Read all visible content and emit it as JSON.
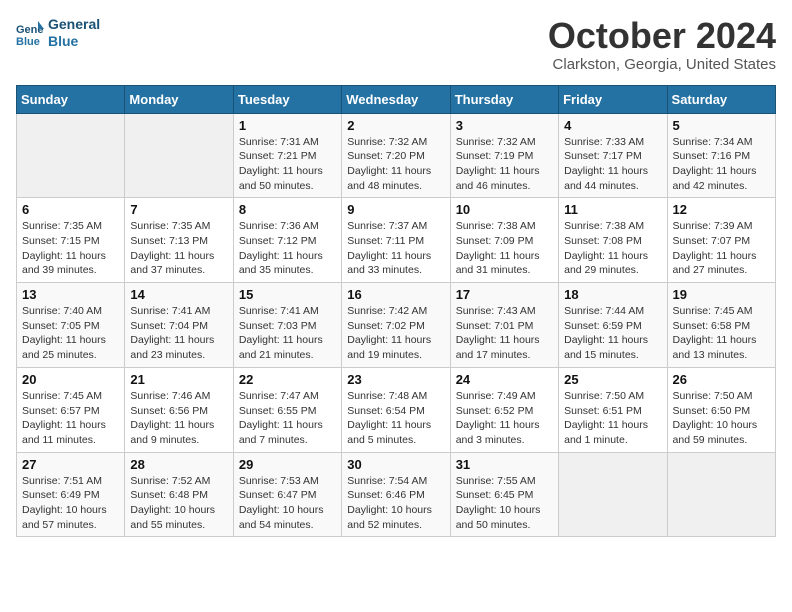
{
  "header": {
    "logo_line1": "General",
    "logo_line2": "Blue",
    "month": "October 2024",
    "location": "Clarkston, Georgia, United States"
  },
  "days_of_week": [
    "Sunday",
    "Monday",
    "Tuesday",
    "Wednesday",
    "Thursday",
    "Friday",
    "Saturday"
  ],
  "weeks": [
    [
      {
        "day": "",
        "info": ""
      },
      {
        "day": "",
        "info": ""
      },
      {
        "day": "1",
        "info": "Sunrise: 7:31 AM\nSunset: 7:21 PM\nDaylight: 11 hours and 50 minutes."
      },
      {
        "day": "2",
        "info": "Sunrise: 7:32 AM\nSunset: 7:20 PM\nDaylight: 11 hours and 48 minutes."
      },
      {
        "day": "3",
        "info": "Sunrise: 7:32 AM\nSunset: 7:19 PM\nDaylight: 11 hours and 46 minutes."
      },
      {
        "day": "4",
        "info": "Sunrise: 7:33 AM\nSunset: 7:17 PM\nDaylight: 11 hours and 44 minutes."
      },
      {
        "day": "5",
        "info": "Sunrise: 7:34 AM\nSunset: 7:16 PM\nDaylight: 11 hours and 42 minutes."
      }
    ],
    [
      {
        "day": "6",
        "info": "Sunrise: 7:35 AM\nSunset: 7:15 PM\nDaylight: 11 hours and 39 minutes."
      },
      {
        "day": "7",
        "info": "Sunrise: 7:35 AM\nSunset: 7:13 PM\nDaylight: 11 hours and 37 minutes."
      },
      {
        "day": "8",
        "info": "Sunrise: 7:36 AM\nSunset: 7:12 PM\nDaylight: 11 hours and 35 minutes."
      },
      {
        "day": "9",
        "info": "Sunrise: 7:37 AM\nSunset: 7:11 PM\nDaylight: 11 hours and 33 minutes."
      },
      {
        "day": "10",
        "info": "Sunrise: 7:38 AM\nSunset: 7:09 PM\nDaylight: 11 hours and 31 minutes."
      },
      {
        "day": "11",
        "info": "Sunrise: 7:38 AM\nSunset: 7:08 PM\nDaylight: 11 hours and 29 minutes."
      },
      {
        "day": "12",
        "info": "Sunrise: 7:39 AM\nSunset: 7:07 PM\nDaylight: 11 hours and 27 minutes."
      }
    ],
    [
      {
        "day": "13",
        "info": "Sunrise: 7:40 AM\nSunset: 7:05 PM\nDaylight: 11 hours and 25 minutes."
      },
      {
        "day": "14",
        "info": "Sunrise: 7:41 AM\nSunset: 7:04 PM\nDaylight: 11 hours and 23 minutes."
      },
      {
        "day": "15",
        "info": "Sunrise: 7:41 AM\nSunset: 7:03 PM\nDaylight: 11 hours and 21 minutes."
      },
      {
        "day": "16",
        "info": "Sunrise: 7:42 AM\nSunset: 7:02 PM\nDaylight: 11 hours and 19 minutes."
      },
      {
        "day": "17",
        "info": "Sunrise: 7:43 AM\nSunset: 7:01 PM\nDaylight: 11 hours and 17 minutes."
      },
      {
        "day": "18",
        "info": "Sunrise: 7:44 AM\nSunset: 6:59 PM\nDaylight: 11 hours and 15 minutes."
      },
      {
        "day": "19",
        "info": "Sunrise: 7:45 AM\nSunset: 6:58 PM\nDaylight: 11 hours and 13 minutes."
      }
    ],
    [
      {
        "day": "20",
        "info": "Sunrise: 7:45 AM\nSunset: 6:57 PM\nDaylight: 11 hours and 11 minutes."
      },
      {
        "day": "21",
        "info": "Sunrise: 7:46 AM\nSunset: 6:56 PM\nDaylight: 11 hours and 9 minutes."
      },
      {
        "day": "22",
        "info": "Sunrise: 7:47 AM\nSunset: 6:55 PM\nDaylight: 11 hours and 7 minutes."
      },
      {
        "day": "23",
        "info": "Sunrise: 7:48 AM\nSunset: 6:54 PM\nDaylight: 11 hours and 5 minutes."
      },
      {
        "day": "24",
        "info": "Sunrise: 7:49 AM\nSunset: 6:52 PM\nDaylight: 11 hours and 3 minutes."
      },
      {
        "day": "25",
        "info": "Sunrise: 7:50 AM\nSunset: 6:51 PM\nDaylight: 11 hours and 1 minute."
      },
      {
        "day": "26",
        "info": "Sunrise: 7:50 AM\nSunset: 6:50 PM\nDaylight: 10 hours and 59 minutes."
      }
    ],
    [
      {
        "day": "27",
        "info": "Sunrise: 7:51 AM\nSunset: 6:49 PM\nDaylight: 10 hours and 57 minutes."
      },
      {
        "day": "28",
        "info": "Sunrise: 7:52 AM\nSunset: 6:48 PM\nDaylight: 10 hours and 55 minutes."
      },
      {
        "day": "29",
        "info": "Sunrise: 7:53 AM\nSunset: 6:47 PM\nDaylight: 10 hours and 54 minutes."
      },
      {
        "day": "30",
        "info": "Sunrise: 7:54 AM\nSunset: 6:46 PM\nDaylight: 10 hours and 52 minutes."
      },
      {
        "day": "31",
        "info": "Sunrise: 7:55 AM\nSunset: 6:45 PM\nDaylight: 10 hours and 50 minutes."
      },
      {
        "day": "",
        "info": ""
      },
      {
        "day": "",
        "info": ""
      }
    ]
  ]
}
